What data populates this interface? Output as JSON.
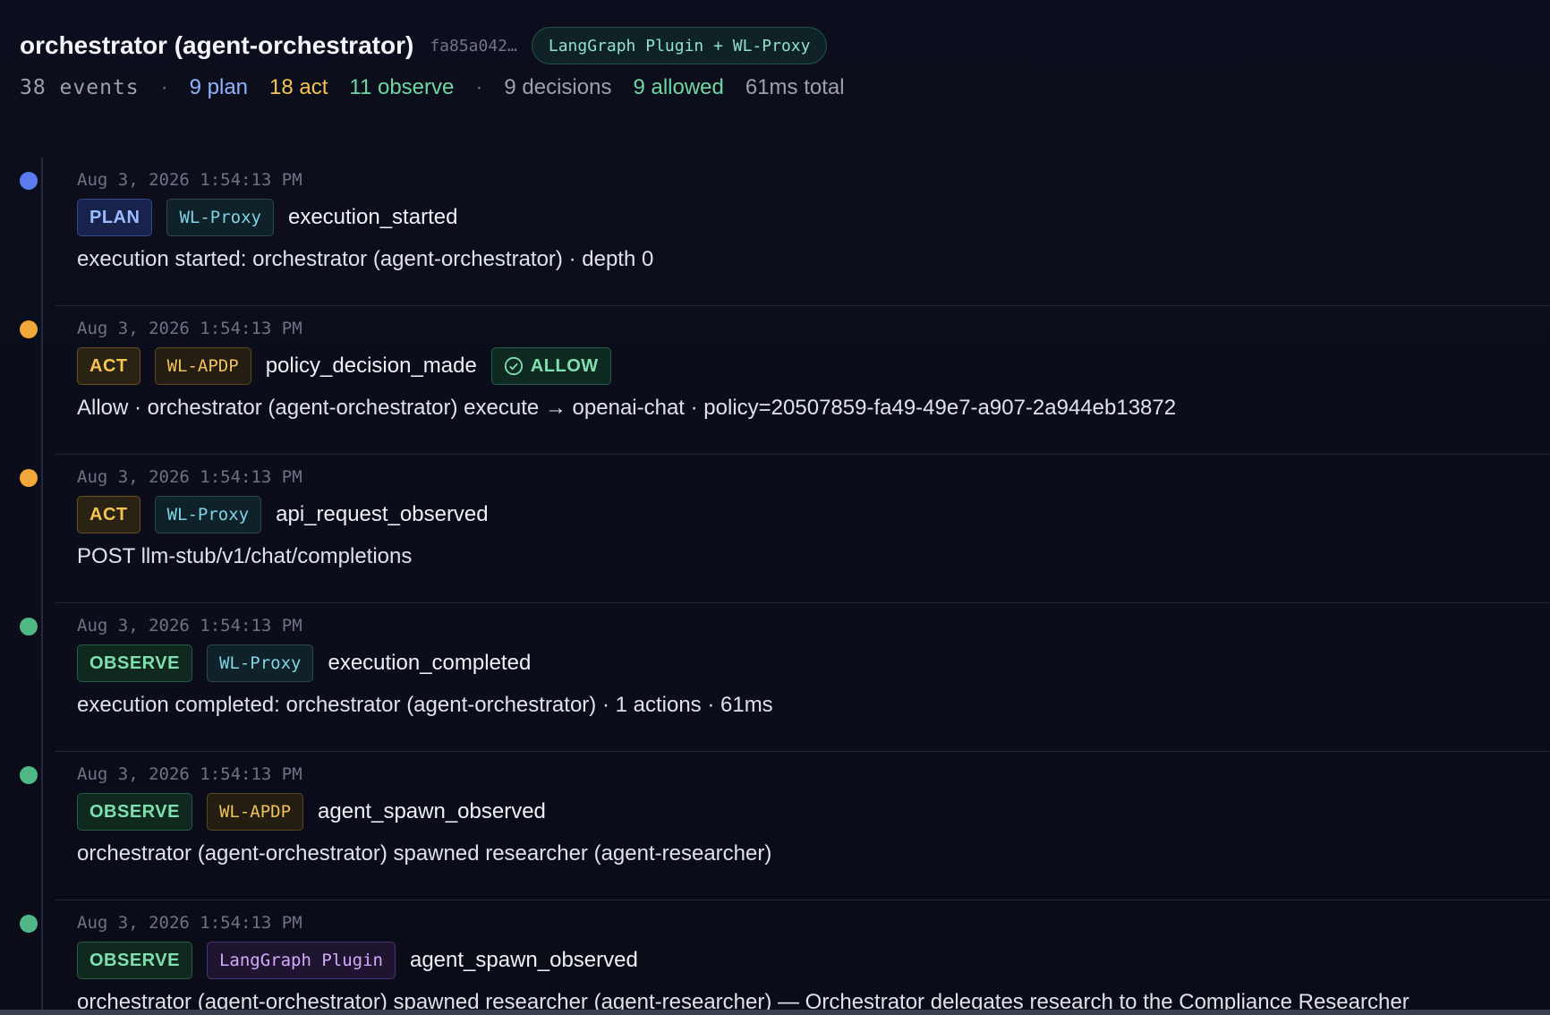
{
  "header": {
    "title": "orchestrator (agent-orchestrator)",
    "hash": "fa85a042…",
    "source_pill": "LangGraph Plugin + WL-Proxy"
  },
  "stats": {
    "events": "38 events",
    "sep1": "·",
    "plan": "9 plan",
    "act": "18 act",
    "observe": "11 observe",
    "sep2": "·",
    "decisions": "9 decisions",
    "allowed": "9 allowed",
    "total": "61ms total"
  },
  "colors": {
    "plan": "#5b7cf0",
    "act": "#f0a83a",
    "observe": "#4fb886",
    "background": "#0b0d1a"
  },
  "events": [
    {
      "timestamp": "Aug 3, 2026 1:54:13 PM",
      "phase": "PLAN",
      "source": "WL-Proxy",
      "type": "execution_started",
      "description": "execution started: orchestrator (agent-orchestrator) · depth 0"
    },
    {
      "timestamp": "Aug 3, 2026 1:54:13 PM",
      "phase": "ACT",
      "source": "WL-APDP",
      "type": "policy_decision_made",
      "verdict": "ALLOW",
      "verdict_icon": "check-circle-icon",
      "description": "Allow · orchestrator (agent-orchestrator) execute → openai-chat · policy=20507859-fa49-49e7-a907-2a944eb13872"
    },
    {
      "timestamp": "Aug 3, 2026 1:54:13 PM",
      "phase": "ACT",
      "source": "WL-Proxy",
      "type": "api_request_observed",
      "description": "POST llm-stub/v1/chat/completions"
    },
    {
      "timestamp": "Aug 3, 2026 1:54:13 PM",
      "phase": "OBSERVE",
      "source": "WL-Proxy",
      "type": "execution_completed",
      "description": "execution completed: orchestrator (agent-orchestrator) · 1 actions · 61ms"
    },
    {
      "timestamp": "Aug 3, 2026 1:54:13 PM",
      "phase": "OBSERVE",
      "source": "WL-APDP",
      "type": "agent_spawn_observed",
      "description": "orchestrator (agent-orchestrator) spawned researcher (agent-researcher)"
    },
    {
      "timestamp": "Aug 3, 2026 1:54:13 PM",
      "phase": "OBSERVE",
      "source": "LangGraph Plugin",
      "type": "agent_spawn_observed",
      "description": "orchestrator (agent-orchestrator) spawned researcher (agent-researcher) — Orchestrator delegates research to the Compliance Researcher"
    }
  ]
}
